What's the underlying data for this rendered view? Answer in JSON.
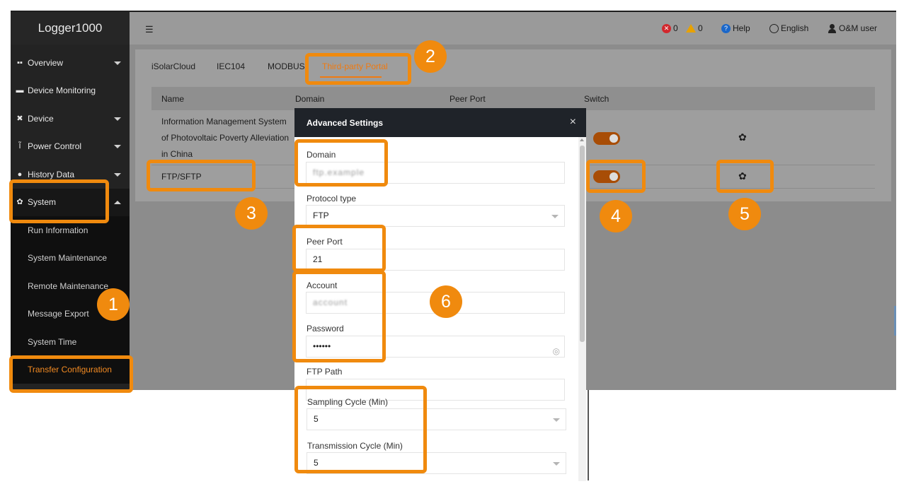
{
  "app_title": "Logger1000",
  "sidebar": {
    "items": [
      {
        "label": "Overview",
        "icon": "grid-icon"
      },
      {
        "label": "Device Monitoring",
        "icon": "monitor-icon"
      },
      {
        "label": "Device",
        "icon": "tools-icon"
      },
      {
        "label": "Power Control",
        "icon": "power-icon"
      },
      {
        "label": "History Data",
        "icon": "history-icon"
      },
      {
        "label": "System",
        "icon": "gear-icon"
      }
    ],
    "system_sub": [
      {
        "label": "Run Information"
      },
      {
        "label": "System Maintenance"
      },
      {
        "label": "Remote Maintenance"
      },
      {
        "label": "Message Export"
      },
      {
        "label": "System Time"
      },
      {
        "label": "Transfer Configuration"
      }
    ]
  },
  "header": {
    "error_count": "0",
    "warning_count": "0",
    "help_label": "Help",
    "language_label": "English",
    "user_label": "O&M user"
  },
  "tabs": [
    "iSolarCloud",
    "IEC104",
    "MODBUS",
    "Third-party Portal"
  ],
  "table": {
    "columns": [
      "Name",
      "Domain",
      "Peer Port",
      "Switch"
    ],
    "rows": [
      {
        "name_lines": [
          "Information Management System",
          "of Photovoltaic Poverty Alleviation",
          "in China"
        ],
        "switch": true
      },
      {
        "name_lines": [
          "FTP/SFTP"
        ],
        "switch": true
      }
    ]
  },
  "dialog": {
    "title": "Advanced Settings",
    "close_glyph": "×",
    "fields": {
      "domain_label": "Domain",
      "domain_value": "ftp.example",
      "protocol_label": "Protocol type",
      "protocol_value": "FTP",
      "peer_port_label": "Peer Port",
      "peer_port_value": "21",
      "account_label": "Account",
      "account_value": "account",
      "password_label": "Password",
      "password_value": "••••••",
      "ftp_path_label": "FTP Path",
      "sampling_label": "Sampling Cycle (Min)",
      "sampling_value": "5",
      "transmission_label": "Transmission Cycle (Min)",
      "transmission_value": "5"
    }
  },
  "annotations": [
    "1",
    "2",
    "3",
    "4",
    "5",
    "6"
  ],
  "colors": {
    "accent_orange": "#f08a0e",
    "sidebar_bg": "#232323",
    "dialog_header": "#1f2329"
  }
}
